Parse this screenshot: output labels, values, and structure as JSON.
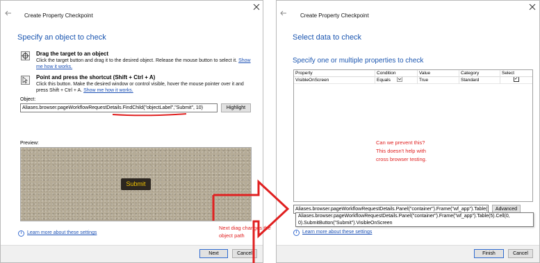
{
  "left_dialog": {
    "window_title": "Create Property Checkpoint",
    "heading": "Specify an object to check",
    "option1": {
      "title": "Drag the target to an object",
      "description": "Click the target button and drag it to the desired object. Release the mouse button to select it.",
      "link": "Show me how it works."
    },
    "option2": {
      "title": "Point and press the shortcut (Shift + Ctrl + A)",
      "description": "Click this button. Make the desired window or control visible, hover the mouse pointer over it and press Shift + Ctrl + A.",
      "link": "Show me how it works."
    },
    "object_label": "Object:",
    "object_value": "Aliases.browser.pageWorkflowRequestDetails.FindChild(\"objectLabel\",\"Submit\", 10)",
    "highlight_button": "Highlight",
    "preview_label": "Preview:",
    "preview_button": "Submit",
    "learn_more": "Learn more about these settings",
    "next_button": "Next",
    "cancel_button": "Cancel"
  },
  "right_dialog": {
    "window_title": "Create Property Checkpoint",
    "heading": "Select data to check",
    "subheading": "Specify one or multiple properties to check",
    "grid": {
      "columns": [
        "Property",
        "Condition",
        "Value",
        "Category",
        "Select"
      ],
      "rows": [
        {
          "property": "VisibleOnScreen",
          "condition": "Equals",
          "value": "True",
          "category": "Standard",
          "selected": true
        }
      ]
    },
    "object_path": "Aliases.browser.pageWorkflowRequestDetails.Panel(\"container\").Frame(\"wf_app\").Table(5).Cel",
    "advanced_button": "Advanced",
    "tooltip": "Aliases.browser.pageWorkflowRequestDetails.Panel(\"container\").Frame(\"wf_app\").Table(5).Cell(0, 0).SubmitButton(\"Submit\").VisibleOnScreen",
    "learn_more": "Learn more about these settings",
    "finish_button": "Finish",
    "cancel_button": "Cancel"
  },
  "annotations": {
    "note_right": [
      "Can we prevent this?",
      "This doesn't help with",
      "cross browser testing."
    ],
    "note_arrow": [
      "Next diag changes the",
      "object path"
    ]
  },
  "colors": {
    "annotation_red": "#e02020",
    "heading_blue": "#1a55b0",
    "submit_text": "#f2c300"
  }
}
